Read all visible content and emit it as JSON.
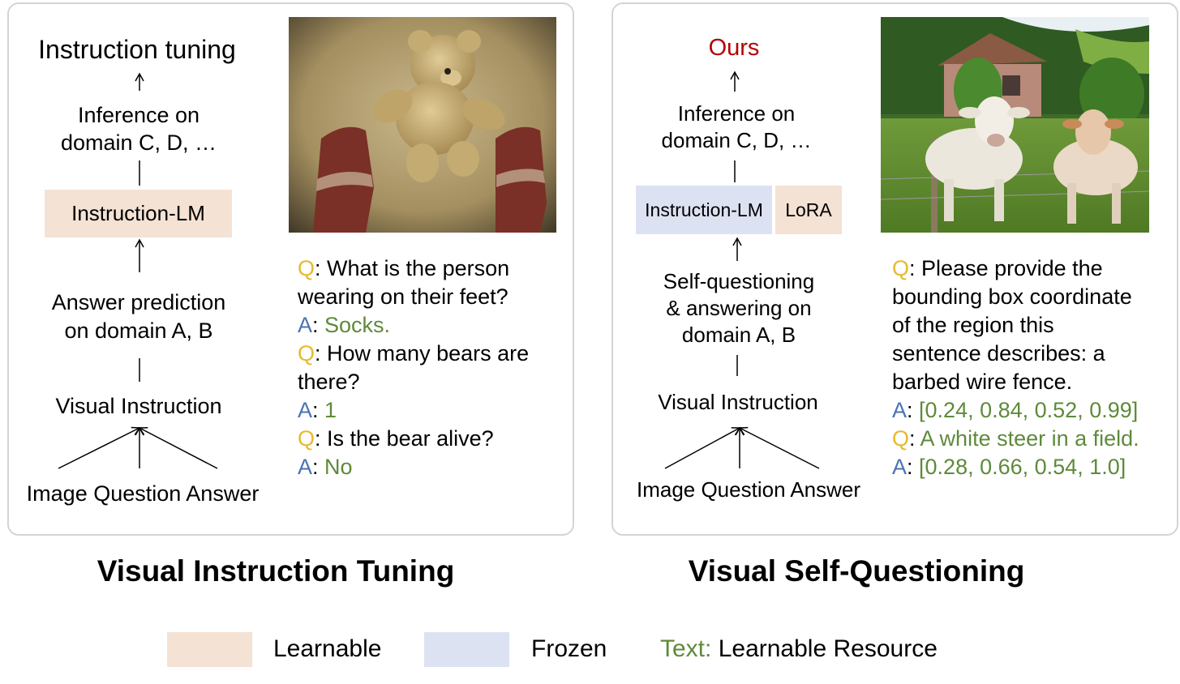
{
  "colors": {
    "learnable": "#f4e2d4",
    "frozen": "#dde2f3",
    "q": "#e8b92e",
    "a": "#4a73b5",
    "answer": "#5e8a3a",
    "ours": "#b30000"
  },
  "left": {
    "title": "Instruction tuning",
    "inference": [
      "Inference on",
      "domain C, D, …"
    ],
    "model": "Instruction-LM",
    "answer_pred": [
      "Answer prediction",
      "on domain A, B"
    ],
    "visual_instruction": "Visual Instruction",
    "inputs": "Image Question Answer",
    "qa": [
      {
        "q": "Q",
        "text": "What is the person"
      },
      {
        "text": "wearing on their feet?"
      },
      {
        "a": "A",
        "answer": "Socks."
      },
      {
        "q": "Q",
        "text": "How many bears are"
      },
      {
        "text": "there?"
      },
      {
        "a": "A",
        "answer": "1"
      },
      {
        "q": "Q",
        "text": "Is the bear alive?"
      },
      {
        "a": "A",
        "answer": "No"
      }
    ],
    "caption": "Visual Instruction Tuning"
  },
  "right": {
    "title": "Ours",
    "inference": [
      "Inference on",
      "domain C, D, …"
    ],
    "model": "Instruction-LM",
    "lora": "LoRA",
    "self_q": [
      "Self-questioning",
      "& answering on",
      "domain A, B"
    ],
    "visual_instruction": "Visual Instruction",
    "inputs": "Image Question Answer",
    "qa": [
      {
        "q": "Q",
        "text": "Please provide the"
      },
      {
        "text": "bounding box coordinate"
      },
      {
        "text": "of the region this"
      },
      {
        "text": "sentence describes: a"
      },
      {
        "text": "barbed wire fence."
      },
      {
        "a": "A",
        "answer": "[0.24, 0.84, 0.52, 0.99]"
      },
      {
        "q": "Q",
        "answer": "A white steer in a field."
      },
      {
        "a": "A",
        "answer": "[0.28, 0.66, 0.54, 1.0]"
      }
    ],
    "caption": "Visual Self-Questioning"
  },
  "legend": {
    "learnable": "Learnable",
    "frozen": "Frozen",
    "text_prefix": "Text:",
    "resource": "Learnable Resource"
  }
}
